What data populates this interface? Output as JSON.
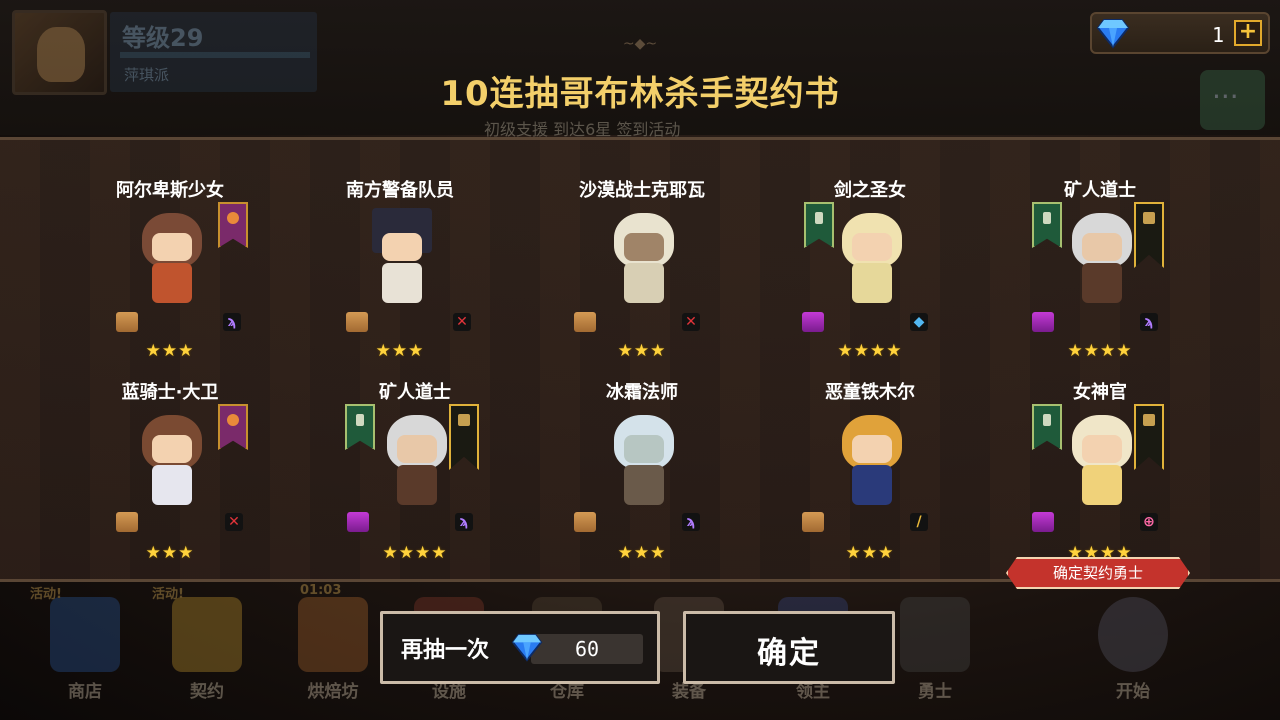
{
  "player": {
    "level": "等级29",
    "name": "萍琪派"
  },
  "currency": {
    "gems": "1",
    "plus": "+"
  },
  "header": {
    "title": "10连抽哥布林杀手契约书",
    "subtabs": "初级支援  到达6星  签到活动"
  },
  "results": [
    {
      "name": "阿尔卑斯少女",
      "stars": "★★★",
      "weapon_icon": "staff-icon"
    },
    {
      "name": "南方警备队员",
      "stars": "★★★",
      "weapon_icon": "crossed-swords-icon"
    },
    {
      "name": "沙漠战士克耶瓦",
      "stars": "★★★",
      "weapon_icon": "crossed-swords-icon"
    },
    {
      "name": "剑之圣女",
      "stars": "★★★★",
      "weapon_icon": "gem-hammer-icon"
    },
    {
      "name": "矿人道士",
      "stars": "★★★★",
      "weapon_icon": "staff-icon"
    },
    {
      "name": "蓝骑士·大卫",
      "stars": "★★★",
      "weapon_icon": "crossed-swords-icon"
    },
    {
      "name": "矿人道士",
      "stars": "★★★★",
      "weapon_icon": "staff-icon"
    },
    {
      "name": "冰霜法师",
      "stars": "★★★",
      "weapon_icon": "staff-icon"
    },
    {
      "name": "恶童铁木尔",
      "stars": "★★★",
      "weapon_icon": "rod-icon"
    },
    {
      "name": "女神官",
      "stars": "★★★★",
      "weapon_icon": "holy-symbol-icon"
    }
  ],
  "confirm_tag": "确定契约勇士",
  "actions": {
    "draw_again": "再抽一次",
    "draw_cost": "60",
    "confirm": "确定"
  },
  "bottom_nav": [
    {
      "label": "商店",
      "badge": "活动!"
    },
    {
      "label": "契约",
      "badge": "活动!"
    },
    {
      "label": "烘焙坊",
      "badge": "01:03"
    },
    {
      "label": "设施",
      "badge": ""
    },
    {
      "label": "仓库",
      "badge": ""
    },
    {
      "label": "装备",
      "badge": ""
    },
    {
      "label": "领主",
      "badge": ""
    },
    {
      "label": "勇士",
      "badge": ""
    },
    {
      "label": "开始",
      "badge": ""
    }
  ]
}
